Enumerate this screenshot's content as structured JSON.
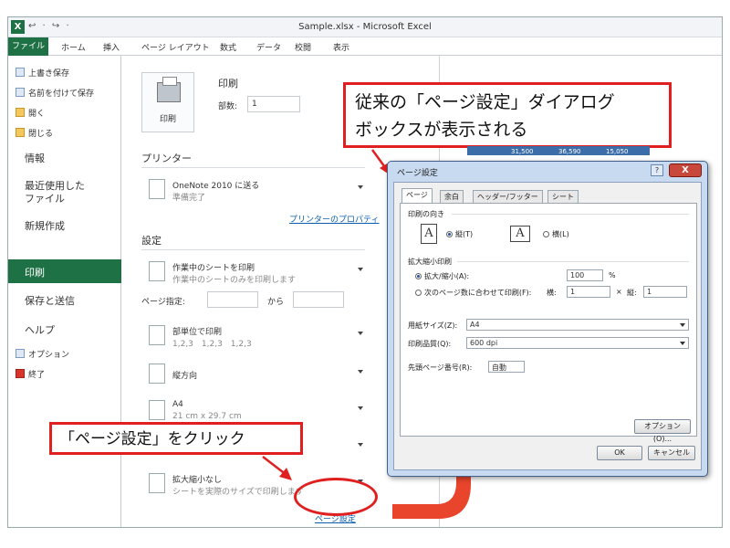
{
  "window": {
    "title": "Sample.xlsx - Microsoft Excel",
    "app_icon": "X",
    "qat": "↩ · ↪ ·"
  },
  "ribbon": {
    "tabs": [
      "ファイル",
      "ホーム",
      "挿入",
      "ページ レイアウト",
      "数式",
      "データ",
      "校閲",
      "表示"
    ]
  },
  "nav": {
    "small_top": [
      "上書き保存",
      "名前を付けて保存",
      "開く",
      "閉じる"
    ],
    "info": "情報",
    "recent_1": "最近使用した",
    "recent_2": "ファイル",
    "new": "新規作成",
    "print": "印刷",
    "save_send": "保存と送信",
    "help": "ヘルプ",
    "options": "オプション",
    "exit": "終了"
  },
  "print": {
    "heading": "印刷",
    "button_label": "印刷",
    "copies_label": "部数:",
    "copies_value": "1",
    "printer_heading": "プリンター",
    "printer_name": "OneNote 2010 に送る",
    "printer_status": "準備完了",
    "printer_props": "プリンターのプロパティ",
    "settings_heading": "設定",
    "what_1": "作業中のシートを印刷",
    "what_2": "作業中のシートのみを印刷します",
    "pages_label": "ページ指定:",
    "pages_to": "から",
    "collate_1": "部単位で印刷",
    "collate_2": "1,2,3　1,2,3　1,2,3",
    "orientation": "縦方向",
    "paper_1": "A4",
    "paper_2": "21 cm x 29.7 cm",
    "scale_1": "拡大縮小なし",
    "scale_2": "シートを実際のサイズで印刷します",
    "page_setup_link": "ページ設定"
  },
  "callouts": {
    "top_line1": "従来の「ページ設定」ダイアログ",
    "top_line2": "ボックスが表示される",
    "bottom": "「ページ設定」をクリック"
  },
  "sheet": {
    "cells": [
      "31,500",
      "36,590",
      "15,050"
    ]
  },
  "dialog": {
    "title": "ページ設定",
    "help": "?",
    "close": "X",
    "tabs": [
      "ページ",
      "余白",
      "ヘッダー/フッター",
      "シート"
    ],
    "orientation_label": "印刷の向き",
    "portrait": "縦(T)",
    "landscape": "横(L)",
    "scale_label": "拡大縮小印刷",
    "scale_pct_label": "拡大/縮小(A):",
    "scale_pct_value": "100",
    "scale_pct_unit": "%",
    "fit_label": "次のページ数に合わせて印刷(F):",
    "fit_w_label": "横:",
    "fit_w_value": "1",
    "fit_x": "×",
    "fit_h_label": "縦:",
    "fit_h_value": "1",
    "paper_label": "用紙サイズ(Z):",
    "paper_value": "A4",
    "quality_label": "印刷品質(Q):",
    "quality_value": "600 dpi",
    "first_page_label": "先頭ページ番号(R):",
    "first_page_value": "自動",
    "options_btn": "オプション(O)...",
    "ok": "OK",
    "cancel": "キャンセル"
  },
  "colors": {
    "excel_green": "#1e7145",
    "callout_red": "#e02020",
    "arrow_red": "#e8452c"
  }
}
